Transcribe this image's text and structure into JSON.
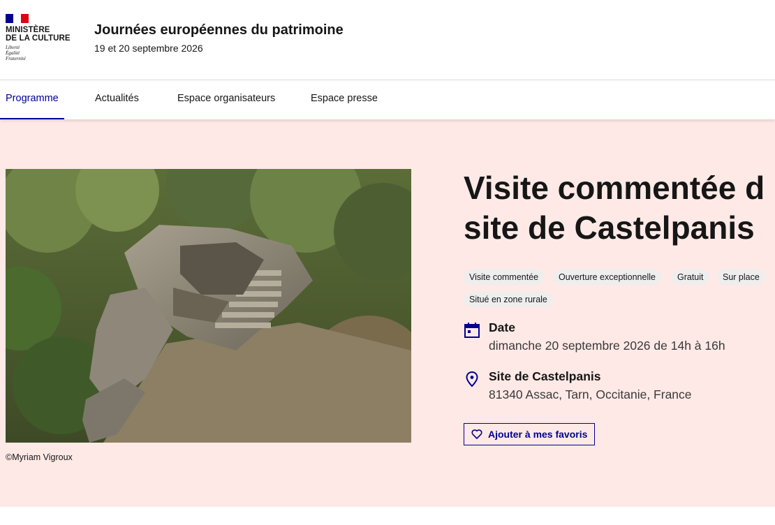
{
  "header": {
    "logo_title_line1": "Ministère",
    "logo_title_line2": "de la Culture",
    "motto_line1": "Liberté",
    "motto_line2": "Égalité",
    "motto_line3": "Fraternité",
    "site_title": "Journées européennes du patrimoine",
    "site_tagline": "19 et 20 septembre 2026",
    "flag_colors": [
      "#000091",
      "#ffffff",
      "#e1000f"
    ]
  },
  "nav": {
    "items": [
      {
        "label": "Programme",
        "active": true
      },
      {
        "label": "Actualités",
        "active": false
      },
      {
        "label": "Espace organisateurs",
        "active": false
      },
      {
        "label": "Espace presse",
        "active": false
      }
    ]
  },
  "event": {
    "photo_caption": "©Myriam Vigroux",
    "title_line1": "Visite commentée d",
    "title_line2": "site de Castelpanis",
    "tags": [
      "Visite commentée",
      "Ouverture exceptionnelle",
      "Gratuit",
      "Sur place",
      "Situé en zone rurale"
    ],
    "date_label": "Date",
    "date_value": "dimanche 20 septembre 2026 de 14h à 16h",
    "place_label": "Site de Castelpanis",
    "place_value": "81340 Assac, Tarn, Occitanie, France",
    "favorite_button": "Ajouter à mes favoris",
    "date_icon": "calendar-icon",
    "place_icon": "map-pin-icon",
    "favorite_icon": "heart-icon"
  },
  "colors": {
    "accent": "#000091",
    "hero_background": "#fee9e6",
    "tag_background": "#eeeeee"
  }
}
